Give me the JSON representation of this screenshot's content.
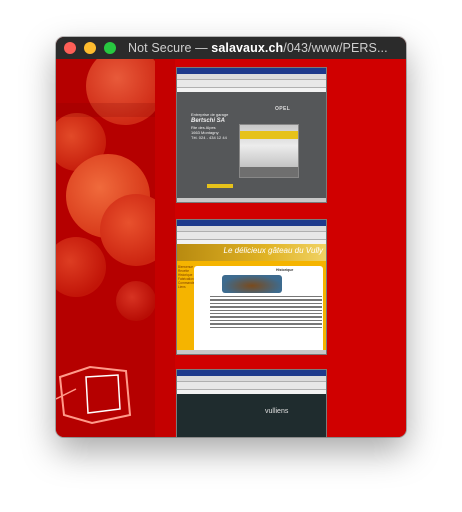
{
  "window": {
    "title_prefix": "Not Secure — ",
    "title_host": "salavaux.ch",
    "title_path": "/043/www/PERS..."
  },
  "thumbnails": [
    {
      "name": "bertschi-page",
      "company_lines": [
        "Entreprise de garage",
        "Bertschi SA",
        "Rte des Alpes",
        "1663 Montagny",
        "Tél. 024 - 434 12 44"
      ],
      "brand": "OPEL"
    },
    {
      "name": "vully-cake-page",
      "header_title": "Le délicieux gâteau du Vully",
      "card_title": "Historique",
      "nav_items": [
        "Bienvenue",
        "Recette",
        "Historique",
        "Fabrication",
        "Commande",
        "Liens"
      ]
    },
    {
      "name": "dark-page",
      "caption": "vulliens"
    }
  ],
  "colors": {
    "background_red": "#cc1a0a",
    "titlebar": "#2b2b2b",
    "accent_yellow": "#f5b400"
  }
}
